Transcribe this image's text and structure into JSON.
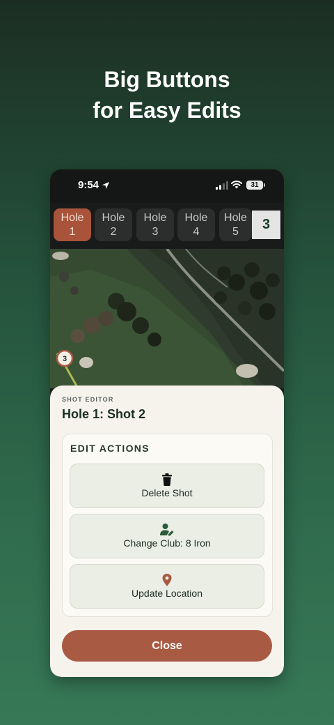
{
  "headline": {
    "line1": "Big Buttons",
    "line2": "for Easy Edits"
  },
  "status_bar": {
    "time": "9:54",
    "battery": "31"
  },
  "holes": [
    {
      "l1": "Hole",
      "l2": "1",
      "active": true
    },
    {
      "l1": "Hole",
      "l2": "2",
      "active": false
    },
    {
      "l1": "Hole",
      "l2": "3",
      "active": false
    },
    {
      "l1": "Hole",
      "l2": "4",
      "active": false
    },
    {
      "l1": "Hole",
      "l2": "5",
      "active": false
    }
  ],
  "hole_count": "3",
  "map": {
    "shot_marker": "3"
  },
  "sheet": {
    "kicker": "SHOT EDITOR",
    "title": "Hole 1: Shot 2",
    "panel_title": "EDIT ACTIONS",
    "actions": [
      {
        "label": "Delete Shot",
        "icon": "trash-icon"
      },
      {
        "label": "Change Club: 8 Iron",
        "icon": "user-edit-icon"
      },
      {
        "label": "Update Location",
        "icon": "location-pin-icon"
      }
    ],
    "close_label": "Close"
  },
  "colors": {
    "accent": "#a85a42",
    "active_hole": "#a9533a",
    "dark_green": "#1d3b29",
    "icon_green": "#2a5a3a"
  }
}
